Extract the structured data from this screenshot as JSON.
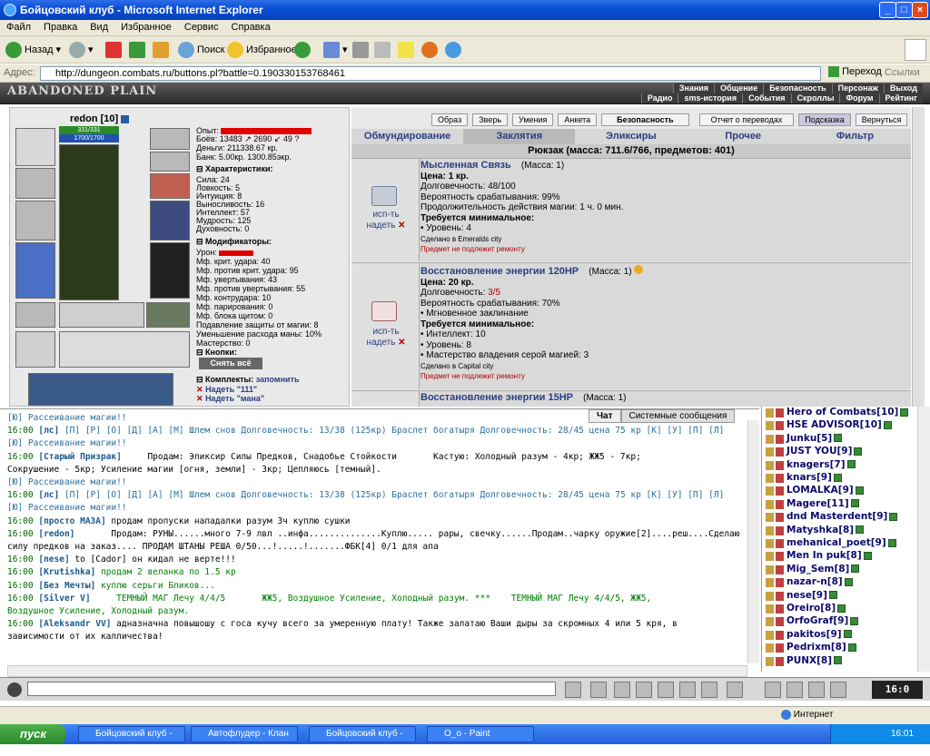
{
  "window": {
    "title": "Бойцовский клуб - Microsoft Internet Explorer"
  },
  "menu": [
    "Файл",
    "Правка",
    "Вид",
    "Избранное",
    "Сервис",
    "Справка"
  ],
  "toolbar": {
    "back": "Назад",
    "search": "Поиск",
    "favorites": "Избранное"
  },
  "address": {
    "label": "Адрес:",
    "url": "http://dungeon.combats.ru/buttons.pl?battle=0.190330153768461",
    "go": "Переход",
    "links": "Ссылки"
  },
  "game": {
    "logo": "ABANDONED PLAIN",
    "nav1": [
      "Знания",
      "Общение",
      "Безопасность",
      "Персонаж",
      "Выход"
    ],
    "nav2": [
      "Радио",
      "sms-история",
      "События",
      "Скроллы",
      "Форум",
      "Рейтинг"
    ]
  },
  "character": {
    "name": "redon",
    "level": "[10]",
    "hp": "331/331",
    "mana": "1700/1700",
    "exp": "Опыт:",
    "battles": "Боёв:   13483 ↗  2690 ↙  49 ?",
    "money": "Деньги: 211338.67 кр.",
    "bank": "Банк: 5.00кр. 1300.85экр.",
    "stats_title": "Характеристики:",
    "stats": [
      "Сила: 24",
      "Ловкость: 5",
      "Интуиция: 8",
      "Выносливость: 16",
      "Интеллект: 57",
      "Мудрость: 125",
      "Духовность: 0"
    ],
    "mods_title": "Модификаторы:",
    "mods": [
      "Урон:",
      "Мф. крит. удара: 40",
      "Мф. против крит. удара: 95",
      "Мф. увертывания: 43",
      "Мф. против увертывания: 55",
      "Мф. контрудара: 10",
      "Мф. парирования: 0",
      "Мф. блока щитом: 0",
      "Подавление защиты от магии: 8",
      "Уменьшение расхода маны: 10%",
      "Мастерство: 0"
    ],
    "buttons_title": "Кнопки:",
    "undress": "Снять всё",
    "sets_title": "Комплекты:",
    "remember": "запомнить",
    "sets": [
      "Надеть \"111\"",
      "Надеть \"мана\""
    ]
  },
  "inventory": {
    "tabs_top": [
      "Образ",
      "Зверь",
      "Умения",
      "Анкета",
      "Безопасность",
      "Отчет о переводах",
      "Подсказка",
      "Вернуться"
    ],
    "tabs": [
      "Обмундирование",
      "Заклятия",
      "Эликсиры",
      "Прочее",
      "Фильтр"
    ],
    "bag": "Рюкзак (масса: 711.6/766, предметов: 401)",
    "use": "исп-ть",
    "wear": "надеть",
    "items": [
      {
        "name": "Мысленная Связь",
        "mass": "(Масса: 1)",
        "price": "Цена: 1 кр.",
        "lines": [
          "Долговечность: 48/100",
          "Вероятность срабатывания: 99%",
          "Продолжительность действия магии: 1 ч. 0 мин."
        ],
        "req_title": "Требуется минимальное:",
        "reqs": [
          "• Уровень: 4"
        ],
        "made": "Сделано в Emeralds city",
        "repair": "Предмет не подлежит ремонту"
      },
      {
        "name": "Восстановление энергии 120HP",
        "mass": "(Масса: 1)",
        "price": "Цена: 20 кр.",
        "dur_label": "Долговечность: ",
        "dur_value": "3/5",
        "lines": [
          "Вероятность срабатывания: 70%",
          "• Мгновенное заклинание"
        ],
        "req_title": "Требуется минимальное:",
        "reqs": [
          "• Интеллект: 10",
          "• Уровень: 8",
          "• Мастерство владения серой магией: 3"
        ],
        "made": "Сделано в Capital city",
        "repair": "Предмет не подлежит ремонту"
      },
      {
        "name": "Восстановление энергии 15HP",
        "mass": "(Масса: 1)"
      }
    ]
  },
  "chat": {
    "tabs": [
      "Чат",
      "Системные сообщения"
    ],
    "lines": [
      {
        "t": "",
        "u": "",
        "msg": "[Ю] Рассеивание магии!!"
      },
      {
        "t": "16:00",
        "u": "[лс]",
        "msg": " [П] [Р] [О] [Д] [А] [М] Шлем снов Долговечность: 13/38 (125кр) Браслет богатыря Долговечность: 28/45 цена 75 кр [К] [У] [П] [Л]"
      },
      {
        "t": "",
        "u": "",
        "msg": "[Ю] Рассеивание магии!!"
      },
      {
        "t": "16:00",
        "u": "[Старый Призрак]",
        "msg": "     Продам: Эликсир Силы Предков, Снадобье Стойкости       Кастую: Холодный разум - 4кр; ЖЖ5 - 7кр;"
      },
      {
        "t": "",
        "u": "",
        "msg": "Сокрушение - 5кр; Усиление магии [огня, земли] - 3кр; Цепляюсь [темный]."
      },
      {
        "t": "",
        "u": "",
        "msg": "[Ю] Рассеивание магии!!"
      },
      {
        "t": "16:00",
        "u": "[лс]",
        "msg": " [П] [Р] [О] [Д] [А] [М] Шлем снов Долговечность: 13/38 (125кр) Браслет богатыря Долговечность: 28/45 цена 75 кр [К] [У] [П] [Л]"
      },
      {
        "t": "",
        "u": "",
        "msg": "[Ю] Рассеивание магии!!"
      },
      {
        "t": "16:00",
        "u": "[просто МАЗА]",
        "msg": " продам пропуски нападалки разум 3ч куплю сушки"
      },
      {
        "t": "16:00",
        "u": "[redon]",
        "msg": "       Продам: РУНЫ......много 7-9 лвл ..инфа..............Куплю..... рары, свечку......Продам..чарку оружие[2]....реш....Сделаю"
      },
      {
        "t": "",
        "u": "",
        "msg": "силу предков на заказ.... ПРОДАМ ШТАНЫ РЕША 0/50...!.....!.......ФБК[4] 0/1 для апа"
      },
      {
        "t": "16:00",
        "u": "[nese]",
        "msg": " to [Cador] он кидал не верте!!!"
      },
      {
        "t": "16:00",
        "u": "[Krutishka]",
        "msg": " продам 2 веланка по 1.5 кр"
      },
      {
        "t": "16:00",
        "u": "[Без Мечты]",
        "msg": " куплю серьги Бликов..."
      },
      {
        "t": "16:00",
        "u": "[Silver V]",
        "msg": "     ТЕМНЫЙ МАГ Лечу 4/4/5       ЖЖ5, Воздушное Усиление, Холодный разум. ***    ТЕМНЫЙ МАГ Лечу 4/4/5, ЖЖ5,"
      },
      {
        "t": "",
        "u": "",
        "msg": "Воздушное Усиление, Холодный разум."
      },
      {
        "t": "16:00",
        "u": "[Aleksandr VV]",
        "msg": " адназначна повышошу с госа кучу всего за умеренную плату! Также залатаю Ваши дыры за скромных 4 или 5 кря, в"
      },
      {
        "t": "",
        "u": "",
        "msg": "зависимости от их калличества!"
      }
    ]
  },
  "players": [
    "Hero of Combats[10]",
    "HSE ADVISOR[10]",
    "Junku[5]",
    "JUST YOU[9]",
    "knagers[7]",
    "knars[9]",
    "LOMALKA[9]",
    "Magere[11]",
    "dnd Masterdent[9]",
    "Matyshka[8]",
    "mehanical_poet[9]",
    "Men In puk[8]",
    "Mig_Sem[8]",
    "nazar-n[8]",
    "nese[9]",
    "Oreiro[8]",
    "OrfoGraf[9]",
    "pakitos[9]",
    "Pedrixm[8]",
    "PUNX[8]"
  ],
  "clock": "16:0",
  "status": {
    "zone": "Интернет"
  },
  "taskbar": {
    "start": "пуск",
    "tasks": [
      "Бойцовский клуб - М...",
      "Автофлудер - Клан ...",
      "Бойцовский клуб - М...",
      "O_o - Paint"
    ],
    "lang": "RU",
    "time": "16:01"
  }
}
